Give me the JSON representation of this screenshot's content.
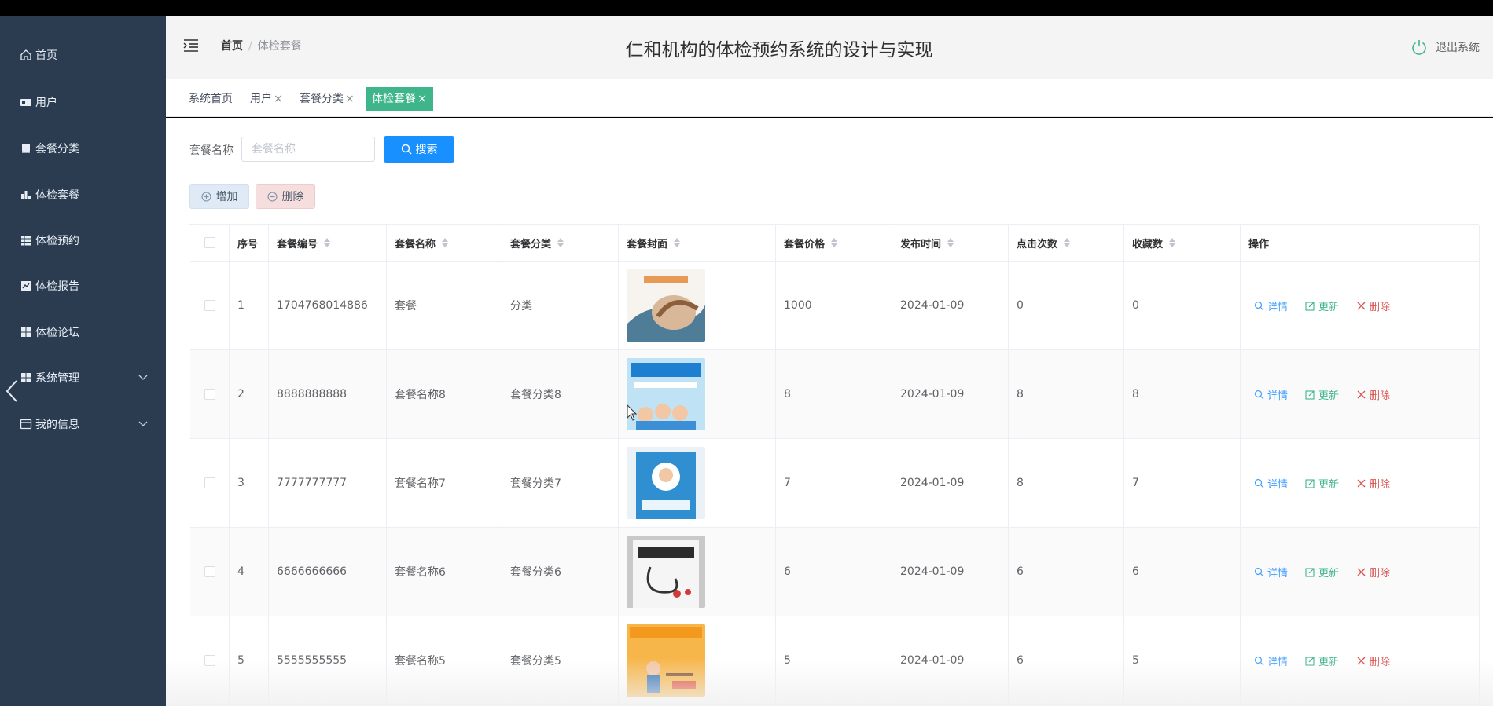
{
  "sidebar": {
    "items": [
      {
        "label": "首页",
        "icon": "home-icon"
      },
      {
        "label": "用户",
        "icon": "user-card-icon"
      },
      {
        "label": "套餐分类",
        "icon": "document-icon"
      },
      {
        "label": "体检套餐",
        "icon": "bar-chart-icon"
      },
      {
        "label": "体检预约",
        "icon": "grid-icon"
      },
      {
        "label": "体检报告",
        "icon": "report-icon"
      },
      {
        "label": "体检论坛",
        "icon": "grid-icon"
      },
      {
        "label": "系统管理",
        "icon": "grid-icon",
        "expandable": true
      },
      {
        "label": "我的信息",
        "icon": "id-card-icon",
        "expandable": true
      }
    ],
    "bg_color": "#2b3b50"
  },
  "header": {
    "breadcrumb": {
      "home": "首页",
      "separator": "/",
      "current": "体检套餐"
    },
    "title": "仁和机构的体检预约系统的设计与实现",
    "logout_label": "退出系统"
  },
  "tabs": [
    {
      "label": "系统首页",
      "closable": false
    },
    {
      "label": "用户",
      "closable": true
    },
    {
      "label": "套餐分类",
      "closable": true
    },
    {
      "label": "体检套餐",
      "closable": true,
      "active": true
    }
  ],
  "tab_close_glyph": "×",
  "search": {
    "label": "套餐名称",
    "placeholder": "套餐名称",
    "button_label": "搜索"
  },
  "actions": {
    "add_label": "增加",
    "delete_label": "删除"
  },
  "table": {
    "columns": [
      "序号",
      "套餐编号",
      "套餐名称",
      "套餐分类",
      "套餐封面",
      "套餐价格",
      "发布时间",
      "点击次数",
      "收藏数",
      "操作"
    ],
    "rows": [
      {
        "index": "1",
        "code": "1704768014886",
        "name": "套餐",
        "category": "分类",
        "price": "1000",
        "date": "2024-01-09",
        "clicks": "0",
        "favorites": "0",
        "cover": "cover-1"
      },
      {
        "index": "2",
        "code": "8888888888",
        "name": "套餐名称8",
        "category": "套餐分类8",
        "price": "8",
        "date": "2024-01-09",
        "clicks": "8",
        "favorites": "8",
        "cover": "cover-2"
      },
      {
        "index": "3",
        "code": "7777777777",
        "name": "套餐名称7",
        "category": "套餐分类7",
        "price": "7",
        "date": "2024-01-09",
        "clicks": "8",
        "favorites": "7",
        "cover": "cover-3"
      },
      {
        "index": "4",
        "code": "6666666666",
        "name": "套餐名称6",
        "category": "套餐分类6",
        "price": "6",
        "date": "2024-01-09",
        "clicks": "6",
        "favorites": "6",
        "cover": "cover-4"
      },
      {
        "index": "5",
        "code": "5555555555",
        "name": "套餐名称5",
        "category": "套餐分类5",
        "price": "5",
        "date": "2024-01-09",
        "clicks": "6",
        "favorites": "5",
        "cover": "cover-5"
      }
    ],
    "row_actions": {
      "detail": "详情",
      "update": "更新",
      "remove": "删除"
    }
  },
  "colors": {
    "accent": "#3eb58a",
    "primary": "#1890ff",
    "danger": "#d9534f",
    "detail_link": "#409eff"
  }
}
